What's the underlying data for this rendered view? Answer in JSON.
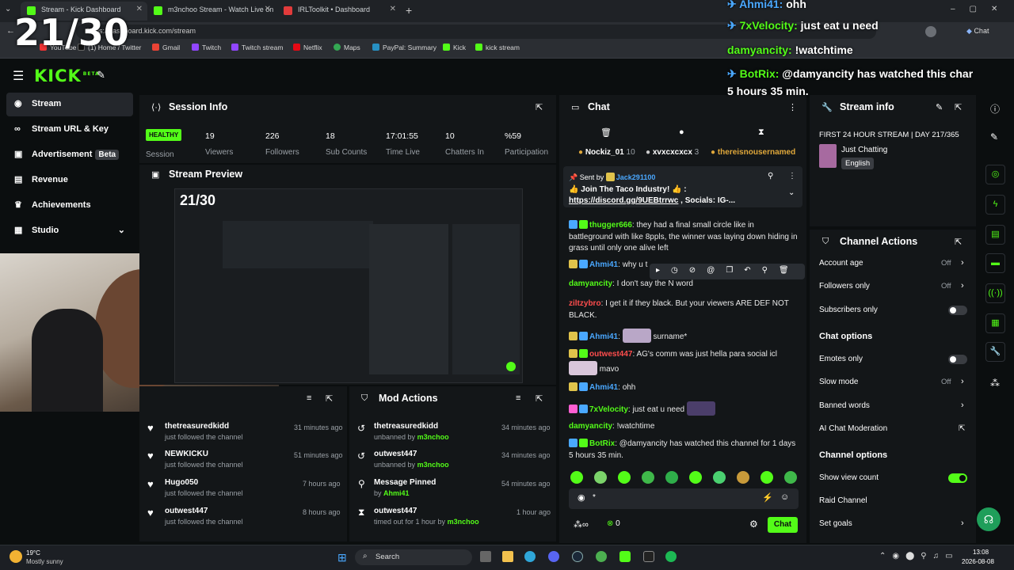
{
  "overlay_counter": "21/30",
  "browser": {
    "tabs": [
      {
        "label": "Stream - Kick Dashboard",
        "active": true
      },
      {
        "label": "m3nchoo Stream - Watch Live on ..."
      },
      {
        "label": "IRLToolkit • Dashboard"
      }
    ],
    "url": "https://dashboard.kick.com/stream",
    "profile": "Chat",
    "bookmarks": [
      "YouTube",
      "(1) Home / Twitter",
      "Gmail",
      "Twitch",
      "Twitch stream",
      "Netflix",
      "Maps",
      "PayPal: Summary",
      "Kick",
      "kick stream"
    ]
  },
  "nav": {
    "logo": "KICK",
    "beta": "BETA"
  },
  "sidebar": {
    "items": [
      {
        "label": "Stream",
        "active": true
      },
      {
        "label": "Stream URL & Key"
      },
      {
        "label": "Advertisement",
        "badge": "Beta"
      },
      {
        "label": "Revenue"
      },
      {
        "label": "Achievements"
      },
      {
        "label": "Studio"
      }
    ]
  },
  "session": {
    "title": "Session Info",
    "health": "HEALTHY",
    "health_label": "Session",
    "stats": [
      {
        "value": "19",
        "label": "Viewers"
      },
      {
        "value": "226",
        "label": "Followers"
      },
      {
        "value": "18",
        "label": "Sub Counts"
      },
      {
        "value": "17:01:55",
        "label": "Time Live"
      },
      {
        "value": "10",
        "label": "Chatters In"
      },
      {
        "value": "%59",
        "label": "Participation"
      }
    ]
  },
  "preview": {
    "title": "Stream Preview",
    "nested_counter": "21/30"
  },
  "followers": [
    {
      "name": "thetreasuredkidd",
      "sub": "just followed the channel",
      "time": "31 minutes ago"
    },
    {
      "name": "NEWKICKU",
      "sub": "just followed the channel",
      "time": "51 minutes ago"
    },
    {
      "name": "Hugo050",
      "sub": "just followed the channel",
      "time": "7 hours ago"
    },
    {
      "name": "outwest447",
      "sub": "just followed the channel",
      "time": "8 hours ago"
    }
  ],
  "mod_actions": {
    "title": "Mod Actions",
    "items": [
      {
        "name": "thetreasuredkidd",
        "sub_prefix": "unbanned by ",
        "actor": "m3nchoo",
        "time": "34 minutes ago"
      },
      {
        "name": "outwest447",
        "sub_prefix": "unbanned by ",
        "actor": "m3nchoo",
        "time": "34 minutes ago"
      },
      {
        "name": "Message Pinned",
        "sub_prefix": "by ",
        "actor": "Ahmi41",
        "time": "54 minutes ago"
      },
      {
        "name": "outwest447",
        "sub_prefix": "timed out for 1 hour by ",
        "actor": "m3nchoo",
        "time": "1 hour ago"
      }
    ]
  },
  "chat": {
    "title": "Chat",
    "top_chatters": [
      {
        "name": "Nockiz_01",
        "count": "10"
      },
      {
        "name": "xvxcxcxcx",
        "count": "3"
      },
      {
        "name": "thereisnousernamed",
        "count": ""
      }
    ],
    "pinned": {
      "sent_by_label": "Sent by",
      "sender": "Jack291100",
      "message": "👍 Join The Taco Industry! 👍 :",
      "link": "https://discord.gg/9UEBtrrwc",
      "suffix": " , Socials: IG-..."
    },
    "messages": [
      {
        "badge": "32",
        "user": "thugger666",
        "text": "they had a final small circle like in battleground with like 8ppls, the winner was laying down hiding in grass until only one alive left"
      },
      {
        "badge": "17",
        "user": "Ahmi41",
        "text": "why u t"
      },
      {
        "user": "damyancity",
        "text": "I don't say the N word"
      },
      {
        "user": "ziltzybro",
        "text": "I get it if they black. But your viewers ARE DEF NOT BLACK."
      },
      {
        "badge": "17",
        "user": "Ahmi41",
        "text": "surname*"
      },
      {
        "badge": "13",
        "user": "outwest447",
        "text": "AG's comm was just hella para social icl",
        "extra": "mavo"
      },
      {
        "badge": "17",
        "user": "Ahmi41",
        "text": "ohh"
      },
      {
        "badge": "20",
        "user": "7xVelocity",
        "text": "just eat u need"
      },
      {
        "user": "damyancity",
        "text": "!watchtime"
      },
      {
        "user": "BotRix",
        "text": "@damyancity has watched this channel for 1 days 5 hours 35 min."
      }
    ],
    "input_placeholder": "*",
    "viewer_count": "0",
    "send_label": "Chat"
  },
  "stream_info": {
    "title": "Stream info",
    "stream_title": "FIRST 24 HOUR STREAM | DAY 217/365",
    "category": "Just Chatting",
    "language": "English"
  },
  "channel_actions": {
    "title": "Channel Actions",
    "rows": [
      {
        "label": "Account age",
        "value": "Off",
        "kind": "chevron"
      },
      {
        "label": "Followers only",
        "value": "Off",
        "kind": "chevron"
      },
      {
        "label": "Subscribers only",
        "kind": "toggle",
        "on": false
      }
    ],
    "chat_options_title": "Chat options",
    "chat_options": [
      {
        "label": "Emotes only",
        "kind": "toggle",
        "on": false
      },
      {
        "label": "Slow mode",
        "value": "Off",
        "kind": "chevron"
      },
      {
        "label": "Banned words",
        "kind": "chevron"
      },
      {
        "label": "AI Chat Moderation",
        "kind": "external"
      }
    ],
    "channel_options_title": "Channel options",
    "channel_options": [
      {
        "label": "Show view count",
        "kind": "toggle",
        "on": true
      },
      {
        "label": "Raid Channel",
        "kind": "none"
      },
      {
        "label": "Set goals",
        "kind": "chevron"
      }
    ]
  },
  "overlay_chat": [
    {
      "user": "Ahmi41:",
      "text": "ohh"
    },
    {
      "user": "7xVelocity:",
      "text": "just eat u need"
    },
    {
      "user": "damyancity:",
      "text": "!watchtime"
    },
    {
      "user": "BotRix:",
      "text": "@damyancity has watched this char"
    },
    {
      "user": "",
      "text": "5 hours 35 min."
    }
  ],
  "taskbar": {
    "weather_temp": "19°C",
    "weather_text": "Mostly sunny",
    "search": "Search",
    "time": "13:08",
    "date": "2026-08-08"
  },
  "colors": {
    "accent": "#53fc18",
    "bg": "#0b0e0f",
    "panel": "#131618"
  }
}
